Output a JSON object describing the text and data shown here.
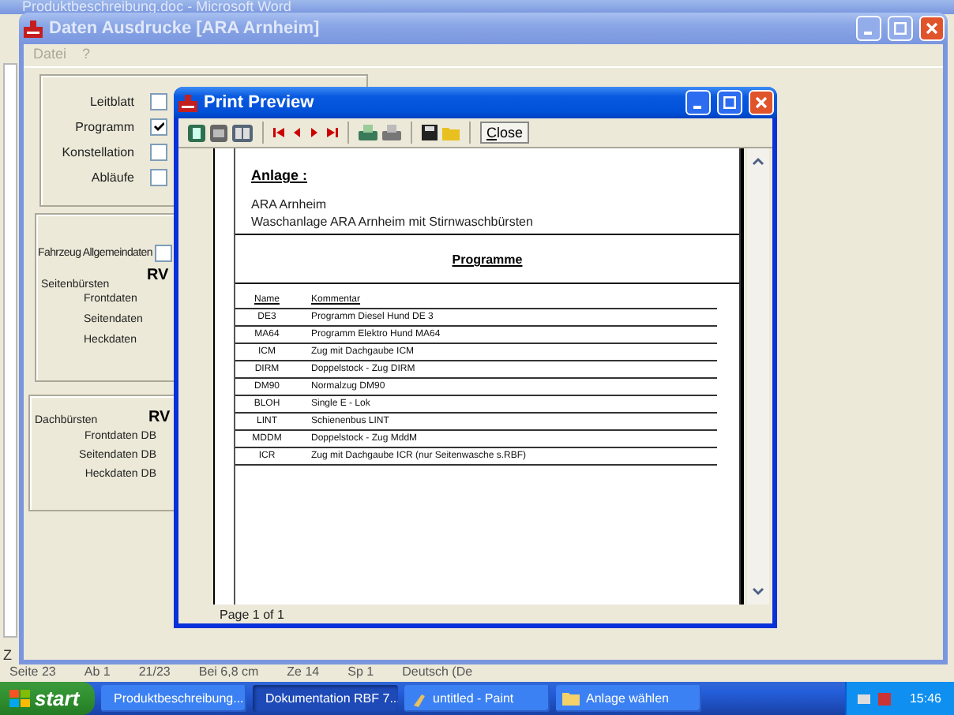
{
  "word_window": {
    "title": "Produktbeschreibung.doc - Microsoft Word",
    "fragment": "Z",
    "status_bar": [
      "Seite 23",
      "Ab 1",
      "21/23",
      "Bei 6,8 cm",
      "Ze 14",
      "Sp 1",
      "Deutsch (De"
    ]
  },
  "data_window": {
    "title": "Daten Ausdrucke [ARA Arnheim]",
    "menu": [
      "Datei",
      "?"
    ],
    "documents": [
      {
        "label": "Leitblatt",
        "checked": false
      },
      {
        "label": "Programm",
        "checked": true
      },
      {
        "label": "Konstellation",
        "checked": false
      },
      {
        "label": "Abläufe",
        "checked": false
      }
    ],
    "vehicle": {
      "label": "Fahrzeug Allgemeindaten",
      "checked": false
    },
    "side_brushes": {
      "label": "Seitenbürsten",
      "code": "RV",
      "items": [
        "Frontdaten",
        "Seitendaten",
        "Heckdaten"
      ]
    },
    "roof_brushes": {
      "label": "Dachbürsten",
      "code": "RV",
      "items": [
        "Frontdaten DB",
        "Seitendaten DB",
        "Heckdaten DB"
      ]
    }
  },
  "preview_window": {
    "title": "Print Preview",
    "close_button": "Close",
    "status": "Page 1 of 1",
    "page": {
      "heading": "Anlage :",
      "lines": [
        "ARA Arnheim",
        "Waschanlage ARA Arnheim mit Stirnwaschbürsten"
      ],
      "section": "Programme",
      "table": {
        "columns": [
          "Name",
          "Kommentar"
        ],
        "rows": [
          [
            "DE3",
            "Programm Diesel Hund DE 3"
          ],
          [
            "MA64",
            "Programm Elektro Hund MA64"
          ],
          [
            "ICM",
            "Zug mit Dachgaube ICM"
          ],
          [
            "DIRM",
            "Doppelstock - Zug DIRM"
          ],
          [
            "DM90",
            "Normalzug DM90"
          ],
          [
            "BLOH",
            "Single E - Lok"
          ],
          [
            "LINT",
            "Schienenbus LINT"
          ],
          [
            "MDDM",
            "Doppelstock - Zug MddM"
          ],
          [
            "ICR",
            "Zug mit Dachgaube ICR (nur Seitenwasche s.RBF)"
          ]
        ]
      }
    }
  },
  "taskbar": {
    "start": "start",
    "tasks": [
      {
        "label": "Produktbeschreibung...",
        "selected": false
      },
      {
        "label": "Dokumentation RBF 7...",
        "selected": true
      },
      {
        "label": "untitled - Paint",
        "selected": false
      },
      {
        "label": "Anlage wählen",
        "selected": false
      }
    ],
    "clock": "15:46"
  }
}
